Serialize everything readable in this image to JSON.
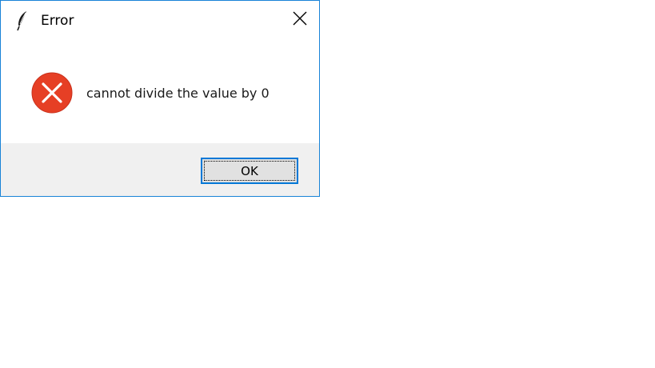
{
  "dialog": {
    "title": "Error",
    "app_icon": "feather-icon",
    "close_icon": "close-icon",
    "message_icon": "error-icon",
    "message": "cannot divide the value by 0",
    "ok_label": "OK"
  },
  "colors": {
    "window_border": "#1883d7",
    "footer_background": "#f0f0f0",
    "error_icon": "#e63f25",
    "button_focus_border": "#0078d7",
    "button_background": "#e1e1e1"
  }
}
